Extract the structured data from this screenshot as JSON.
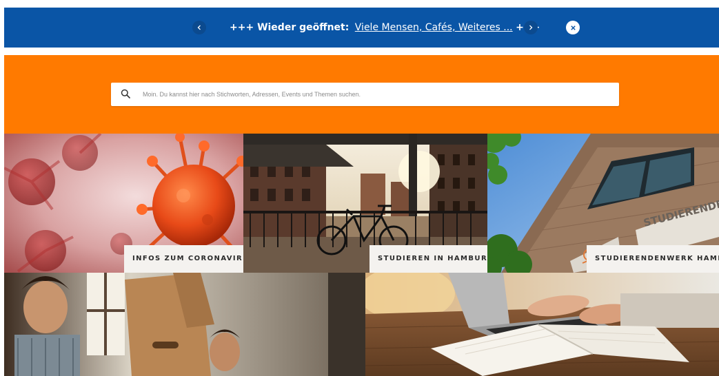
{
  "announcement": {
    "prefix": "+++ Wieder geöffnet:",
    "link_text": "Viele Mensen, Cafés, Weiteres ...",
    "suffix": "+++",
    "colors": {
      "background": "#0a55a6",
      "text": "#ffffff"
    }
  },
  "search": {
    "placeholder": "Moin. Du kannst hier nach Stichworten, Adressen, Events und Themen suchen.",
    "value": "",
    "icon": "search-icon",
    "band_color": "#ff7a00"
  },
  "tiles": [
    {
      "caption": "INFOS ZUM CORONAVIRUS"
    },
    {
      "caption": "STUDIEREN IN HAMBURG"
    },
    {
      "caption": "STUDIERENDENWERK HAMBURG"
    },
    {
      "caption": ""
    },
    {
      "caption": ""
    }
  ],
  "signage": {
    "building_text": "STUDIERENDEN"
  }
}
